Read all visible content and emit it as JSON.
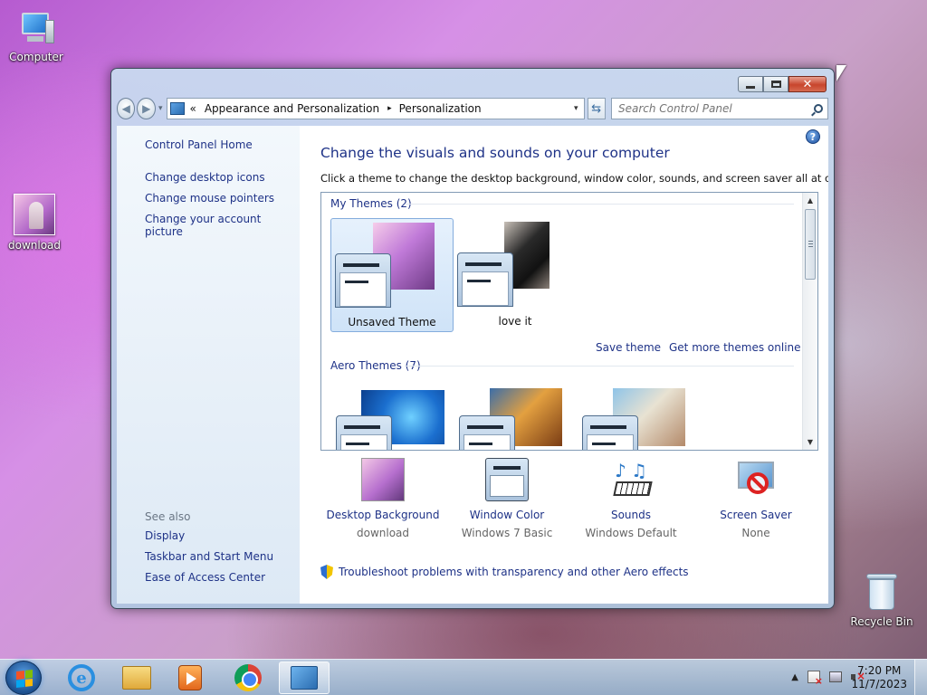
{
  "desktop": {
    "icons": [
      {
        "label": "Computer",
        "icon": "computer-icon"
      },
      {
        "label": "download",
        "icon": "image-file-icon"
      },
      {
        "label": "Recycle Bin",
        "icon": "recycle-bin-icon"
      }
    ]
  },
  "window": {
    "close_glyph": "✕",
    "address": {
      "overflow": "«",
      "crumbs": [
        "Appearance and Personalization",
        "Personalization"
      ],
      "separator": "▸",
      "dropdown": "▾"
    },
    "search": {
      "placeholder": "Search Control Panel"
    },
    "help": "?",
    "sidebar": {
      "home": "Control Panel Home",
      "links": [
        "Change desktop icons",
        "Change mouse pointers",
        "Change your account picture"
      ],
      "see_also_title": "See also",
      "see_also": [
        "Display",
        "Taskbar and Start Menu",
        "Ease of Access Center"
      ]
    },
    "main": {
      "heading": "Change the visuals and sounds on your computer",
      "description": "Click a theme to change the desktop background, window color, sounds, and screen saver all at once.",
      "my_themes_label": "My Themes (2)",
      "my_themes": [
        {
          "name": "Unsaved Theme",
          "selected": true
        },
        {
          "name": "love it",
          "selected": false
        }
      ],
      "save_theme": "Save theme",
      "get_more": "Get more themes online",
      "aero_themes_label": "Aero Themes (7)",
      "bottom": [
        {
          "label": "Desktop Background",
          "value": "download"
        },
        {
          "label": "Window Color",
          "value": "Windows 7 Basic"
        },
        {
          "label": "Sounds",
          "value": "Windows Default"
        },
        {
          "label": "Screen Saver",
          "value": "None"
        }
      ],
      "troubleshoot": "Troubleshoot problems with transparency and other Aero effects"
    }
  },
  "taskbar": {
    "time": "7:20 PM",
    "date": "11/7/2023",
    "tray_expand": "▲"
  },
  "colors": {
    "link": "#1e3287",
    "close_red": "#c8452c",
    "selected_tile": "#cfe3f8"
  }
}
